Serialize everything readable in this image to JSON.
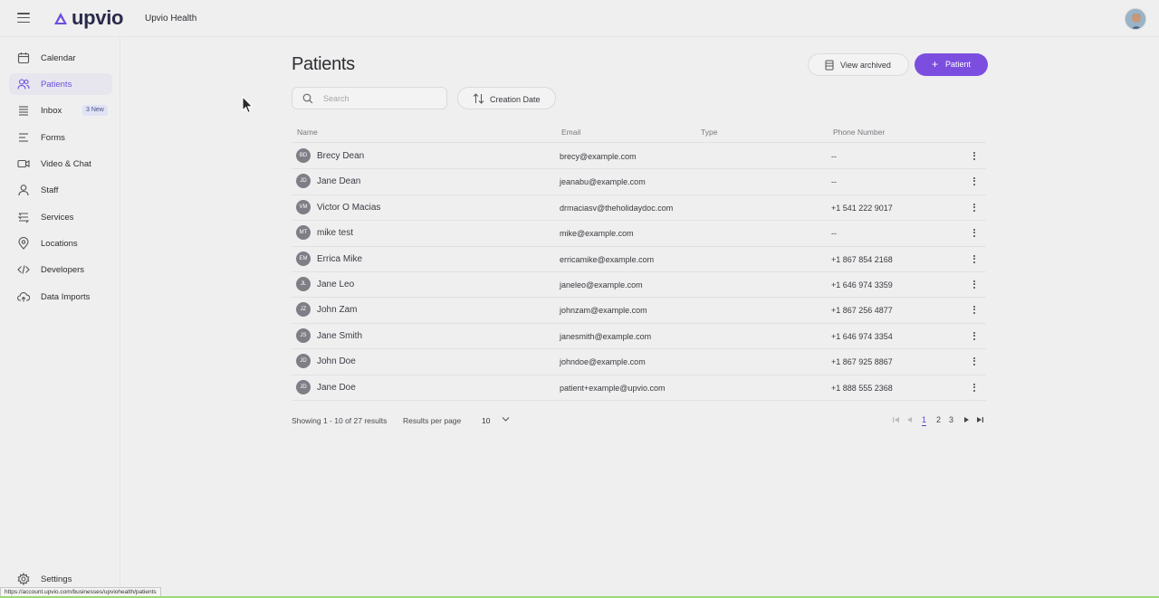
{
  "app": {
    "logo_text": "upvio",
    "org_name": "Upvio Health",
    "brand_color": "#7b4ee0"
  },
  "sidebar": {
    "items": [
      {
        "label": "Calendar",
        "icon": "calendar-icon"
      },
      {
        "label": "Patients",
        "icon": "patients-icon",
        "active": true
      },
      {
        "label": "Inbox",
        "icon": "inbox-icon",
        "badge": "3 New"
      },
      {
        "label": "Forms",
        "icon": "forms-icon"
      },
      {
        "label": "Video & Chat",
        "icon": "video-icon"
      },
      {
        "label": "Staff",
        "icon": "staff-icon"
      },
      {
        "label": "Services",
        "icon": "services-icon"
      },
      {
        "label": "Locations",
        "icon": "location-pin-icon"
      },
      {
        "label": "Developers",
        "icon": "code-icon"
      },
      {
        "label": "Data Imports",
        "icon": "cloud-upload-icon"
      }
    ],
    "settings_label": "Settings"
  },
  "main": {
    "title": "Patients",
    "view_archived_label": "View archived",
    "add_patient_label": "Patient",
    "search_placeholder": "Search",
    "sort_label": "Creation Date",
    "columns": [
      "Name",
      "Email",
      "Type",
      "Phone Number"
    ],
    "rows": [
      {
        "initials": "BD",
        "name": "Brecy Dean",
        "email": "brecy@example.com",
        "type": "",
        "phone": "--"
      },
      {
        "initials": "JD",
        "name": "Jane Dean",
        "email": "jeanabu@example.com",
        "type": "",
        "phone": "--"
      },
      {
        "initials": "VM",
        "name": "Victor O Macias",
        "email": "drmaciasv@theholidaydoc.com",
        "type": "",
        "phone": "+1 541 222 9017"
      },
      {
        "initials": "MT",
        "name": "mike test",
        "email": "mike@example.com",
        "type": "",
        "phone": "--"
      },
      {
        "initials": "EM",
        "name": "Errica Mike",
        "email": "erricamike@example.com",
        "type": "",
        "phone": "+1 867 854 2168"
      },
      {
        "initials": "JL",
        "name": "Jane Leo",
        "email": "janeleo@example.com",
        "type": "",
        "phone": "+1 646 974 3359"
      },
      {
        "initials": "JZ",
        "name": "John Zam",
        "email": "johnzam@example.com",
        "type": "",
        "phone": "+1 867 256 4877"
      },
      {
        "initials": "JS",
        "name": "Jane Smith",
        "email": "janesmith@example.com",
        "type": "",
        "phone": "+1 646 974 3354"
      },
      {
        "initials": "JD",
        "name": "John Doe",
        "email": "johndoe@example.com",
        "type": "",
        "phone": "+1 867 925 8867"
      },
      {
        "initials": "JD",
        "name": "Jane Doe",
        "email": "patient+example@upvio.com",
        "type": "",
        "phone": "+1 888 555 2368"
      }
    ],
    "showing_text": "Showing 1 - 10 of 27 results",
    "results_per_page_label": "Results per page",
    "results_per_page_value": "10",
    "pages": [
      "1",
      "2",
      "3"
    ],
    "current_page": "1"
  },
  "status_bar": {
    "url": "https://account.upvio.com/businesses/upviohealth/patients"
  }
}
